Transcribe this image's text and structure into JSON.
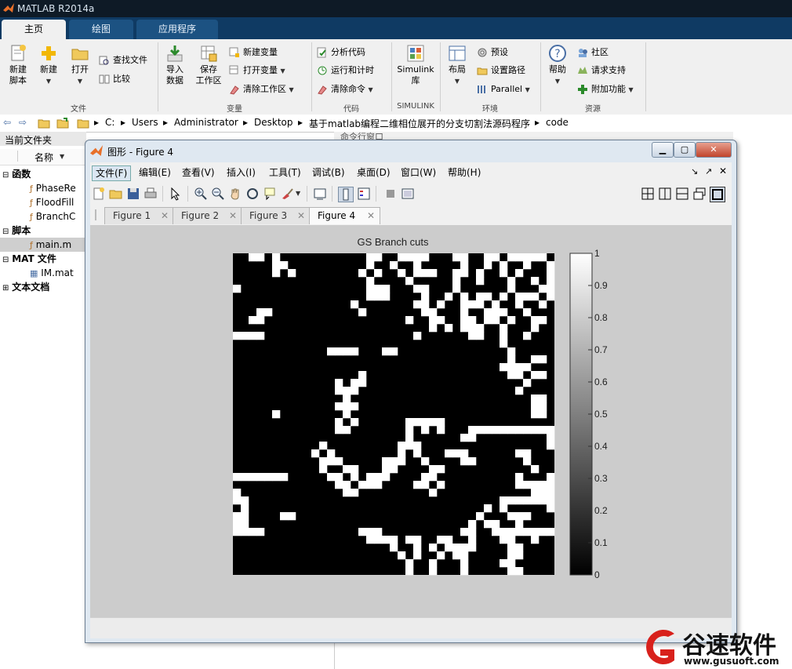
{
  "app": {
    "title": "MATLAB R2014a"
  },
  "ribbon_tabs": [
    "主页",
    "绘图",
    "应用程序"
  ],
  "ribbon": {
    "file": {
      "new_script": "新建\n脚本",
      "new": "新建",
      "open": "打开",
      "find_files": "查找文件",
      "compare": "比较",
      "label": "文件"
    },
    "variable": {
      "import": "导入\n数据",
      "save_ws": "保存\n工作区",
      "new_var": "新建变量",
      "open_var": "打开变量",
      "clear_ws": "清除工作区",
      "label": "变量"
    },
    "code": {
      "analyze": "分析代码",
      "run_time": "运行和计时",
      "clear_cmd": "清除命令",
      "label": "代码"
    },
    "simulink": {
      "lib": "Simulink\n库",
      "label": "SIMULINK"
    },
    "env": {
      "layout": "布局",
      "prefs": "预设",
      "set_path": "设置路径",
      "parallel": "Parallel",
      "label": "环境"
    },
    "resources": {
      "help": "帮助",
      "community": "社区",
      "support": "请求支持",
      "addons": "附加功能",
      "label": "资源"
    }
  },
  "address": {
    "crumbs": [
      "C:",
      "Users",
      "Administrator",
      "Desktop",
      "基于matlab编程二维相位展开的分支切割法源码程序",
      "code"
    ]
  },
  "left_panel": {
    "title": "当前文件夹",
    "column": "名称",
    "groups": [
      {
        "label": "函数",
        "items": [
          "PhaseRe",
          "FloodFill",
          "BranchC"
        ]
      },
      {
        "label": "脚本",
        "items": [
          "main.m"
        ]
      },
      {
        "label": "MAT 文件",
        "items": [
          "IM.mat"
        ]
      },
      {
        "label": "文本文档",
        "items": []
      }
    ]
  },
  "behind_panel": {
    "title": "命令行窗口"
  },
  "figure": {
    "title": "图形 - Figure 4",
    "menus": [
      "文件(F)",
      "编辑(E)",
      "查看(V)",
      "插入(I)",
      "工具(T)",
      "调试(B)",
      "桌面(D)",
      "窗口(W)",
      "帮助(H)"
    ],
    "tabs": [
      "Figure 1",
      "Figure 2",
      "Figure 3",
      "Figure 4"
    ],
    "active_tab": "Figure 4"
  },
  "chart_data": {
    "type": "heatmap",
    "title": "GS Branch cuts",
    "colormap": "gray",
    "clim": [
      0,
      1
    ],
    "colorbar_ticks": [
      "0",
      "0.1",
      "0.2",
      "0.3",
      "0.4",
      "0.5",
      "0.6",
      "0.7",
      "0.8",
      "0.9",
      "1"
    ],
    "grid_size": [
      41,
      41
    ],
    "values": [
      "00000000000000000000000000000000000000000",
      "00000000000000000000000000000000000000000",
      "00000000000000000000000000000000000000000",
      "00000000000000000000000000000000000000000",
      "00000000000000000000000000000000000000000",
      "00000000000000000000000000000000000000000",
      "00000000000000000000000000000000000000000",
      "00000000000000000000000000000000000000000",
      "00000000000000000000000000000000000000000",
      "00000000000000000000000000000000000000000",
      "00000000000000000000000000000000000000000",
      "00000000000000000000000000000000000000000",
      "00000000000000000000000000000000000000000",
      "00000000000000000000000000000000000000000",
      "00000000000000000000000000000000000000000",
      "00000000000000000000000000000000000000000",
      "00000000000000000000000000000000000000000",
      "00000000000000000000000000000000000000000",
      "00000000000000000000000000000000000000000",
      "00000000000000000000000000000000000000000",
      "00000000000000000000000000000000000000000",
      "00000000000000000000000000000000000000000",
      "00000000000000000000000000000000000000000",
      "00000000000000000000000000000000000000000",
      "00000000000000000000000000000000000000000",
      "00000000000000000000000000000000000000000",
      "00000000000000000000000000000000000000000",
      "00000000000000000000000000000000000000000",
      "00000000000000000000000000000000000000000",
      "00000000000000000000000000000000000000000",
      "00000000000000000000000000000000000000000",
      "00000000000000000000000000000000000000000",
      "00000000000000000000000000000000000000000",
      "00000000000000000000000000000000000000000",
      "00000000000000000000000000000000000000000",
      "00000000000000000000000000000000000000000",
      "00000000000000000000000000000000000000000",
      "00000000000000000000000000000000000000000",
      "00000000000000000000000000000000000000000",
      "00000000000000000000000000000000000000000",
      "00000000000000000000000000000000000000000"
    ],
    "white_cells": [
      [
        0,
        2
      ],
      [
        0,
        3
      ],
      [
        0,
        5
      ],
      [
        0,
        17
      ],
      [
        0,
        18
      ],
      [
        0,
        21
      ],
      [
        0,
        22
      ],
      [
        0,
        23
      ],
      [
        0,
        24
      ],
      [
        0,
        28
      ],
      [
        0,
        29
      ],
      [
        0,
        32
      ],
      [
        0,
        33
      ],
      [
        0,
        35
      ],
      [
        0,
        36
      ],
      [
        0,
        37
      ],
      [
        0,
        38
      ],
      [
        0,
        39
      ],
      [
        1,
        5
      ],
      [
        1,
        6
      ],
      [
        1,
        17
      ],
      [
        1,
        20
      ],
      [
        1,
        23
      ],
      [
        1,
        29
      ],
      [
        1,
        32
      ],
      [
        1,
        34
      ],
      [
        1,
        37
      ],
      [
        1,
        40
      ],
      [
        2,
        5
      ],
      [
        2,
        7
      ],
      [
        2,
        16
      ],
      [
        2,
        18
      ],
      [
        2,
        21
      ],
      [
        2,
        23
      ],
      [
        2,
        24
      ],
      [
        2,
        25
      ],
      [
        2,
        28
      ],
      [
        2,
        29
      ],
      [
        2,
        31
      ],
      [
        2,
        34
      ],
      [
        2,
        36
      ],
      [
        2,
        40
      ],
      [
        3,
        17
      ],
      [
        3,
        22
      ],
      [
        3,
        28
      ],
      [
        3,
        31
      ],
      [
        3,
        35
      ],
      [
        3,
        38
      ],
      [
        3,
        40
      ],
      [
        4,
        0
      ],
      [
        4,
        17
      ],
      [
        4,
        18
      ],
      [
        4,
        19
      ],
      [
        4,
        23
      ],
      [
        4,
        24
      ],
      [
        4,
        28
      ],
      [
        4,
        35
      ],
      [
        4,
        39
      ],
      [
        4,
        40
      ],
      [
        5,
        17
      ],
      [
        5,
        18
      ],
      [
        5,
        19
      ],
      [
        5,
        24
      ],
      [
        5,
        27
      ],
      [
        5,
        29
      ],
      [
        5,
        31
      ],
      [
        5,
        32
      ],
      [
        5,
        34
      ],
      [
        5,
        36
      ],
      [
        5,
        37
      ],
      [
        5,
        38
      ],
      [
        5,
        40
      ],
      [
        6,
        15
      ],
      [
        6,
        23
      ],
      [
        6,
        24
      ],
      [
        6,
        26
      ],
      [
        6,
        29
      ],
      [
        6,
        30
      ],
      [
        6,
        31
      ],
      [
        6,
        33
      ],
      [
        6,
        36
      ],
      [
        6,
        39
      ],
      [
        7,
        3
      ],
      [
        7,
        4
      ],
      [
        7,
        16
      ],
      [
        7,
        24
      ],
      [
        7,
        25
      ],
      [
        7,
        29
      ],
      [
        7,
        32
      ],
      [
        7,
        33
      ],
      [
        7,
        34
      ],
      [
        7,
        37
      ],
      [
        8,
        2
      ],
      [
        8,
        3
      ],
      [
        8,
        22
      ],
      [
        8,
        25
      ],
      [
        8,
        26
      ],
      [
        8,
        29
      ],
      [
        8,
        30
      ],
      [
        8,
        32
      ],
      [
        8,
        33
      ],
      [
        8,
        35
      ],
      [
        8,
        38
      ],
      [
        8,
        39
      ],
      [
        9,
        25
      ],
      [
        9,
        27
      ],
      [
        9,
        29
      ],
      [
        9,
        30
      ],
      [
        9,
        31
      ],
      [
        9,
        34
      ],
      [
        9,
        38
      ],
      [
        10,
        0
      ],
      [
        10,
        1
      ],
      [
        10,
        2
      ],
      [
        10,
        3
      ],
      [
        10,
        23
      ],
      [
        10,
        30
      ],
      [
        10,
        31
      ],
      [
        10,
        34
      ],
      [
        10,
        37
      ],
      [
        11,
        34
      ],
      [
        12,
        12
      ],
      [
        12,
        13
      ],
      [
        12,
        14
      ],
      [
        12,
        15
      ],
      [
        12,
        19
      ],
      [
        12,
        20
      ],
      [
        12,
        35
      ],
      [
        13,
        35
      ],
      [
        13,
        38
      ],
      [
        13,
        39
      ],
      [
        14,
        34
      ],
      [
        14,
        35
      ],
      [
        14,
        36
      ],
      [
        14,
        37
      ],
      [
        15,
        16
      ],
      [
        15,
        35
      ],
      [
        15,
        36
      ],
      [
        15,
        38
      ],
      [
        15,
        39
      ],
      [
        16,
        13
      ],
      [
        16,
        15
      ],
      [
        16,
        16
      ],
      [
        16,
        37
      ],
      [
        17,
        13
      ],
      [
        17,
        14
      ],
      [
        17,
        15
      ],
      [
        17,
        36
      ],
      [
        18,
        14
      ],
      [
        18,
        38
      ],
      [
        18,
        39
      ],
      [
        19,
        13
      ],
      [
        19,
        14
      ],
      [
        19,
        15
      ],
      [
        19,
        38
      ],
      [
        19,
        39
      ],
      [
        20,
        5
      ],
      [
        20,
        14
      ],
      [
        20,
        38
      ],
      [
        20,
        39
      ],
      [
        21,
        13
      ],
      [
        21,
        15
      ],
      [
        21,
        22
      ],
      [
        21,
        23
      ],
      [
        21,
        24
      ],
      [
        21,
        25
      ],
      [
        21,
        26
      ],
      [
        22,
        13
      ],
      [
        22,
        14
      ],
      [
        22,
        22
      ],
      [
        22,
        24
      ],
      [
        22,
        26
      ],
      [
        22,
        30
      ],
      [
        22,
        31
      ],
      [
        22,
        32
      ],
      [
        22,
        33
      ],
      [
        22,
        34
      ],
      [
        22,
        35
      ],
      [
        22,
        36
      ],
      [
        22,
        37
      ],
      [
        22,
        38
      ],
      [
        22,
        39
      ],
      [
        22,
        40
      ],
      [
        23,
        22
      ],
      [
        23,
        29
      ],
      [
        23,
        30
      ],
      [
        23,
        40
      ],
      [
        24,
        11
      ],
      [
        24,
        21
      ],
      [
        24,
        22
      ],
      [
        24,
        23
      ],
      [
        24,
        40
      ],
      [
        25,
        10
      ],
      [
        25,
        12
      ],
      [
        25,
        21
      ],
      [
        25,
        23
      ],
      [
        25,
        27
      ],
      [
        25,
        28
      ],
      [
        25,
        29
      ],
      [
        25,
        36
      ],
      [
        25,
        37
      ],
      [
        26,
        11
      ],
      [
        26,
        12
      ],
      [
        26,
        13
      ],
      [
        26,
        19
      ],
      [
        26,
        20
      ],
      [
        26,
        21
      ],
      [
        26,
        24
      ],
      [
        26,
        29
      ],
      [
        26,
        30
      ],
      [
        26,
        37
      ],
      [
        27,
        11
      ],
      [
        27,
        14
      ],
      [
        27,
        15
      ],
      [
        27,
        19
      ],
      [
        27,
        20
      ],
      [
        27,
        25
      ],
      [
        27,
        26
      ],
      [
        27,
        38
      ],
      [
        28,
        0
      ],
      [
        28,
        1
      ],
      [
        28,
        2
      ],
      [
        28,
        3
      ],
      [
        28,
        4
      ],
      [
        28,
        5
      ],
      [
        28,
        6
      ],
      [
        28,
        12
      ],
      [
        28,
        13
      ],
      [
        28,
        15
      ],
      [
        28,
        17
      ],
      [
        28,
        18
      ],
      [
        28,
        19
      ],
      [
        28,
        24
      ],
      [
        28,
        25
      ],
      [
        28,
        36
      ],
      [
        28,
        40
      ],
      [
        29,
        13
      ],
      [
        29,
        14
      ],
      [
        29,
        16
      ],
      [
        29,
        17
      ],
      [
        29,
        18
      ],
      [
        29,
        23
      ],
      [
        29,
        24
      ],
      [
        29,
        26
      ],
      [
        29,
        36
      ],
      [
        29,
        37
      ],
      [
        29,
        38
      ],
      [
        29,
        39
      ],
      [
        29,
        40
      ],
      [
        30,
        0
      ],
      [
        30,
        14
      ],
      [
        30,
        15
      ],
      [
        30,
        25
      ],
      [
        30,
        38
      ],
      [
        30,
        39
      ],
      [
        30,
        40
      ],
      [
        31,
        0
      ],
      [
        31,
        1
      ],
      [
        31,
        34
      ],
      [
        31,
        35
      ],
      [
        31,
        36
      ],
      [
        31,
        37
      ],
      [
        31,
        38
      ],
      [
        31,
        39
      ],
      [
        31,
        40
      ],
      [
        32,
        1
      ],
      [
        32,
        32
      ],
      [
        32,
        34
      ],
      [
        32,
        40
      ],
      [
        33,
        0
      ],
      [
        33,
        1
      ],
      [
        33,
        6
      ],
      [
        33,
        7
      ],
      [
        33,
        31
      ],
      [
        33,
        35
      ],
      [
        33,
        36
      ],
      [
        33,
        37
      ],
      [
        34,
        0
      ],
      [
        34,
        1
      ],
      [
        34,
        30
      ],
      [
        34,
        32
      ],
      [
        34,
        33
      ],
      [
        34,
        36
      ],
      [
        35,
        0
      ],
      [
        35,
        1
      ],
      [
        35,
        2
      ],
      [
        35,
        3
      ],
      [
        35,
        16
      ],
      [
        35,
        17
      ],
      [
        35,
        18
      ],
      [
        35,
        29
      ],
      [
        35,
        30
      ],
      [
        35,
        33
      ],
      [
        35,
        34
      ],
      [
        35,
        35
      ],
      [
        35,
        36
      ],
      [
        35,
        37
      ],
      [
        35,
        38
      ],
      [
        35,
        39
      ],
      [
        35,
        40
      ],
      [
        36,
        17
      ],
      [
        36,
        18
      ],
      [
        36,
        19
      ],
      [
        36,
        20
      ],
      [
        36,
        22
      ],
      [
        36,
        23
      ],
      [
        36,
        26
      ],
      [
        36,
        27
      ],
      [
        36,
        30
      ],
      [
        36,
        34
      ],
      [
        36,
        35
      ],
      [
        36,
        38
      ],
      [
        37,
        20
      ],
      [
        37,
        23
      ],
      [
        37,
        25
      ],
      [
        37,
        27
      ],
      [
        37,
        28
      ],
      [
        37,
        29
      ],
      [
        37,
        30
      ],
      [
        37,
        35
      ],
      [
        37,
        36
      ],
      [
        38,
        21
      ],
      [
        38,
        23
      ],
      [
        38,
        26
      ],
      [
        38,
        28
      ],
      [
        38,
        29
      ],
      [
        38,
        35
      ],
      [
        38,
        36
      ],
      [
        39,
        22
      ],
      [
        39,
        25
      ],
      [
        39,
        29
      ],
      [
        39,
        34
      ],
      [
        39,
        35
      ],
      [
        40,
        22
      ],
      [
        40,
        25
      ],
      [
        40,
        29
      ],
      [
        40,
        35
      ],
      [
        40,
        36
      ]
    ]
  },
  "watermark": {
    "brand": "谷速软件",
    "url": "www.gusuoft.com"
  }
}
